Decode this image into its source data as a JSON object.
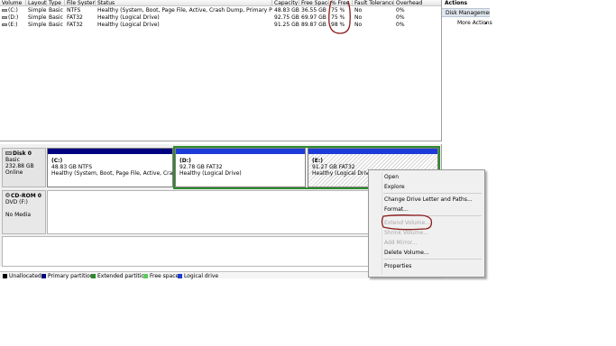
{
  "volume_list": {
    "headers": [
      "Volume",
      "Layout",
      "Type",
      "File System",
      "Status",
      "Capacity",
      "Free Space",
      "% Free",
      "Fault Tolerance",
      "Overhead"
    ],
    "rows": [
      [
        "(C:)",
        "Simple",
        "Basic",
        "NTFS",
        "Healthy (System, Boot, Page File, Active, Crash Dump, Primary Partition)",
        "48.83 GB",
        "36.55 GB",
        "75 %",
        "No",
        "0%"
      ],
      [
        "(D:)",
        "Simple",
        "Basic",
        "FAT32",
        "Healthy (Logical Drive)",
        "92.75 GB",
        "69.97 GB",
        "75 %",
        "No",
        "0%"
      ],
      [
        "(E:)",
        "Simple",
        "Basic",
        "FAT32",
        "Healthy (Logical Drive)",
        "91.25 GB",
        "89.87 GB",
        "98 %",
        "No",
        "0%"
      ]
    ]
  },
  "actions": {
    "title": "Actions",
    "section": "Disk Management",
    "more": "More Actions",
    "more_arrow": "▸"
  },
  "disks": {
    "disk0": {
      "name": "Disk 0",
      "type": "Basic",
      "size": "232.88 GB",
      "status": "Online"
    },
    "cdrom0": {
      "name": "CD-ROM 0",
      "type": "DVD (F:)",
      "status": "No Media"
    }
  },
  "partitions": {
    "c": {
      "name": "(C:)",
      "detail": "48.83 GB NTFS",
      "status": "Healthy (System, Boot, Page File, Active, Crash Du"
    },
    "d": {
      "name": "(D:)",
      "detail": "92.78 GB FAT32",
      "status": "Healthy (Logical Drive)"
    },
    "e": {
      "name": "(E:)",
      "detail": "91.27 GB FAT32",
      "status": "Healthy (Logical Drive)"
    }
  },
  "legend": {
    "items": [
      {
        "label": "Unallocated",
        "color": "#000000"
      },
      {
        "label": "Primary partition",
        "color": "#000080"
      },
      {
        "label": "Extended partition",
        "color": "#2d8a2d"
      },
      {
        "label": "Free space",
        "color": "#5ccc5c"
      },
      {
        "label": "Logical drive",
        "color": "#1c3bd8"
      }
    ]
  },
  "context_menu": {
    "items": [
      {
        "label": "Open",
        "enabled": true
      },
      {
        "label": "Explore",
        "enabled": true
      },
      {
        "label": "Change Drive Letter and Paths...",
        "enabled": true
      },
      {
        "label": "Format...",
        "enabled": true
      },
      {
        "label": "Extend Volume...",
        "enabled": false
      },
      {
        "label": "Shrink Volume...",
        "enabled": false
      },
      {
        "label": "Add Mirror...",
        "enabled": false
      },
      {
        "label": "Delete Volume...",
        "enabled": true
      },
      {
        "label": "Properties",
        "enabled": true
      }
    ]
  },
  "colors": {
    "primary_bar": "#000080",
    "logical_bar": "#1c3bd8",
    "extended_frame": "#2d8a2d",
    "annotation": "#8b1a1a",
    "selected_pane": "#dfe6ee"
  }
}
